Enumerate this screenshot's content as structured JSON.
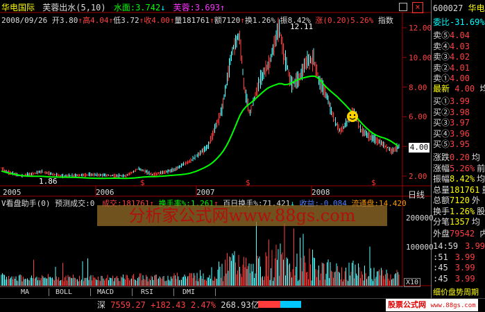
{
  "header": {
    "stock_name": "华电国际",
    "indicator": "芙蓉出水(5,10)",
    "water_label": "水面:3.742",
    "water_arrow": "↓",
    "lotus_label": "芙蓉:3.693",
    "lotus_arrow": "↑",
    "close_icon": "×"
  },
  "quote_line": {
    "date": "2008/09/26",
    "open": "开3.80",
    "high": "高4.04",
    "low": "低3.72",
    "close": "收4.00",
    "volume": "量181761",
    "amount": "额7120",
    "turnover": "换1.26%",
    "amplitude": "振8.42%",
    "change": "涨(0.20)5.26%",
    "index_btn": "指数"
  },
  "price_axis": [
    "12.00",
    "10.00",
    "8.00",
    "6.00",
    "4.00",
    "2.00"
  ],
  "price_tag": "4.00",
  "annotations": {
    "high_label": "12.11",
    "low_label": "1.86"
  },
  "years": [
    "2005",
    "2006",
    "2007",
    "2008"
  ],
  "period": "日线",
  "volume_header": {
    "title": "V看盘助手(0)",
    "forecast": "预测成交:0",
    "volume": "成交:181761",
    "turnover_rate": "换手率%:1.261",
    "hundred_day": "百日换手%:71.421",
    "profit": "收益:-0.084",
    "float": "流通盘:14.420"
  },
  "watermark": "分析家公式网www.88gs.com",
  "volume_axis": [
    "200000",
    "100000"
  ],
  "volume_unit": "X10",
  "tabs": [
    "MA",
    "BOLL",
    "MACD",
    "RSI",
    "DMI"
  ],
  "status_bar": {
    "index_name": "深",
    "value": "7559.27",
    "change": "+182.43",
    "pct": "2.47%",
    "amount": "268.93亿",
    "site": "股票公式网",
    "site_url": "www.88gs.com"
  },
  "right_panel": {
    "code": "600027",
    "name": "华电",
    "ratio": "委比-31.69%",
    "ratio_tail": "委",
    "sell": [
      {
        "label": "卖⑤",
        "price": "4.04"
      },
      {
        "label": "卖④",
        "price": "4.03"
      },
      {
        "label": "卖③",
        "price": "4.02"
      },
      {
        "label": "卖②",
        "price": "4.01"
      },
      {
        "label": "卖①",
        "price": "4.00"
      }
    ],
    "latest": {
      "label": "最新",
      "price": "4.00",
      "tail": "均"
    },
    "buy": [
      {
        "label": "买①",
        "price": "3.99"
      },
      {
        "label": "买②",
        "price": "3.98"
      },
      {
        "label": "买③",
        "price": "3.97"
      },
      {
        "label": "买④",
        "price": "3.96"
      },
      {
        "label": "买⑤",
        "price": "3.95"
      }
    ],
    "stats": [
      {
        "label": "涨跌",
        "value": "0.20",
        "tail": "均"
      },
      {
        "label": "涨幅",
        "value": "5.26%",
        "tail": "前"
      },
      {
        "label": "振幅",
        "value": "8.42%",
        "tail": "均"
      },
      {
        "label": "总量",
        "value": "181761",
        "tail": "量"
      },
      {
        "label": "总额",
        "value": "7120",
        "tail": "外"
      },
      {
        "label": "换手",
        "value": "1.26%",
        "tail": "股"
      },
      {
        "label": "分笔",
        "value": "1357",
        "tail": "均"
      }
    ],
    "outer": {
      "label": "外盘",
      "value": "79542",
      "tail": "内"
    },
    "ticks": [
      {
        "time": "14:59",
        "price": "3.99"
      },
      {
        "time": ":51",
        "price": "3.99"
      },
      {
        "time": ":45",
        "price": "3.99"
      },
      {
        "time": ":45",
        "price": "3.99"
      }
    ],
    "footer": "细价盘势周期"
  },
  "colors": {
    "up": "#ff3c3c",
    "down": "#54ffff",
    "lotus": "#00ff00",
    "water": "#ffff00",
    "label": "#00ffff"
  }
}
